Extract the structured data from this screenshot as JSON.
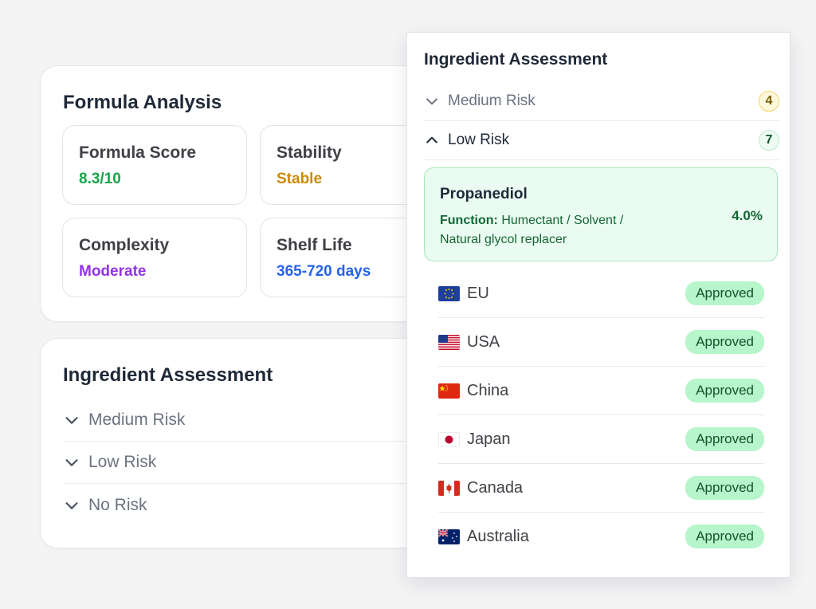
{
  "formula": {
    "title": "Formula Analysis",
    "metrics": [
      {
        "label": "Formula Score",
        "value": "8.3/10",
        "color": "#16a34a"
      },
      {
        "label": "Stability",
        "value": "Stable",
        "color": "#ca8a04"
      },
      {
        "label": "Complexity",
        "value": "Moderate",
        "color": "#9333ea"
      },
      {
        "label": "Shelf Life",
        "value": "365-720 days",
        "color": "#2563eb"
      }
    ]
  },
  "assessment_card": {
    "title": "Ingredient Assessment",
    "rows": [
      {
        "label": "Medium Risk",
        "icon": "chevron-down-icon"
      },
      {
        "label": "Low Risk",
        "icon": "chevron-down-icon"
      },
      {
        "label": "No Risk",
        "icon": "chevron-down-icon"
      }
    ]
  },
  "panel": {
    "title": "Ingredient Assessment",
    "medium": {
      "label": "Medium Risk",
      "count": "4",
      "icon": "chevron-down-icon"
    },
    "low": {
      "label": "Low Risk",
      "count": "7",
      "icon": "chevron-up-icon"
    },
    "ingredient": {
      "name": "Propanediol",
      "function_label": "Function:",
      "function_text": "Humectant / Solvent / Natural glycol replacer",
      "percent": "4.0%"
    },
    "regions": [
      {
        "name": "EU",
        "status": "Approved",
        "flag": "eu-flag-icon"
      },
      {
        "name": "USA",
        "status": "Approved",
        "flag": "us-flag-icon"
      },
      {
        "name": "China",
        "status": "Approved",
        "flag": "china-flag-icon"
      },
      {
        "name": "Japan",
        "status": "Approved",
        "flag": "japan-flag-icon"
      },
      {
        "name": "Canada",
        "status": "Approved",
        "flag": "canada-flag-icon"
      },
      {
        "name": "Australia",
        "status": "Approved",
        "flag": "australia-flag-icon"
      }
    ]
  }
}
